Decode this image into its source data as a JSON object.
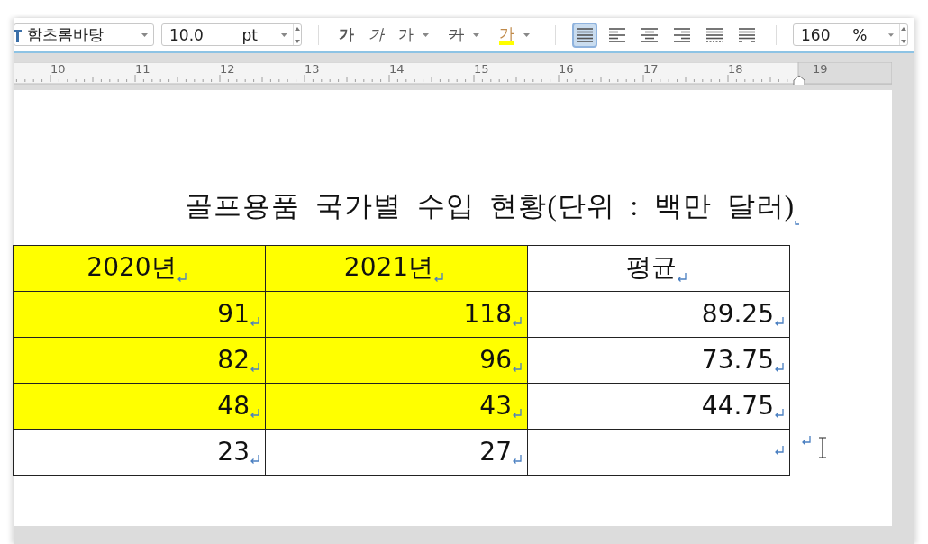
{
  "toolbar": {
    "font": "함초롬바탕",
    "size": "10.0",
    "size_unit": "pt",
    "char_styles": [
      {
        "kind": "bold",
        "label": "가"
      },
      {
        "kind": "italic",
        "label": "가"
      },
      {
        "kind": "underline",
        "label": "가"
      },
      {
        "kind": "strike",
        "label": "가"
      },
      {
        "kind": "color",
        "label": "가"
      }
    ],
    "align": [
      {
        "kind": "justify",
        "selected": true
      },
      {
        "kind": "left",
        "selected": false
      },
      {
        "kind": "center",
        "selected": false
      },
      {
        "kind": "right",
        "selected": false
      },
      {
        "kind": "distribute",
        "selected": false
      },
      {
        "kind": "split",
        "selected": false
      }
    ],
    "zoom": "160",
    "zoom_unit": "%"
  },
  "ruler": {
    "labels": [
      "10",
      "11",
      "12",
      "13",
      "14",
      "15",
      "16",
      "17",
      "18",
      "19"
    ]
  },
  "document": {
    "title": "골프용품 국가별 수입 현황(단위 : 백만 달러)",
    "table": {
      "rows": [
        [
          {
            "text": "2020년",
            "highlight": true,
            "header": true
          },
          {
            "text": "2021년",
            "highlight": true,
            "header": true
          },
          {
            "text": "평균",
            "highlight": false,
            "header": true
          }
        ],
        [
          {
            "text": "91",
            "highlight": true
          },
          {
            "text": "118",
            "highlight": true
          },
          {
            "text": "89.25",
            "highlight": false
          }
        ],
        [
          {
            "text": "82",
            "highlight": true
          },
          {
            "text": "96",
            "highlight": true
          },
          {
            "text": "73.75",
            "highlight": false
          }
        ],
        [
          {
            "text": "48",
            "highlight": true
          },
          {
            "text": "43",
            "highlight": true
          },
          {
            "text": "44.75",
            "highlight": false
          }
        ],
        [
          {
            "text": "23",
            "highlight": false
          },
          {
            "text": "27",
            "highlight": false
          },
          {
            "highlight": false
          }
        ]
      ]
    }
  }
}
